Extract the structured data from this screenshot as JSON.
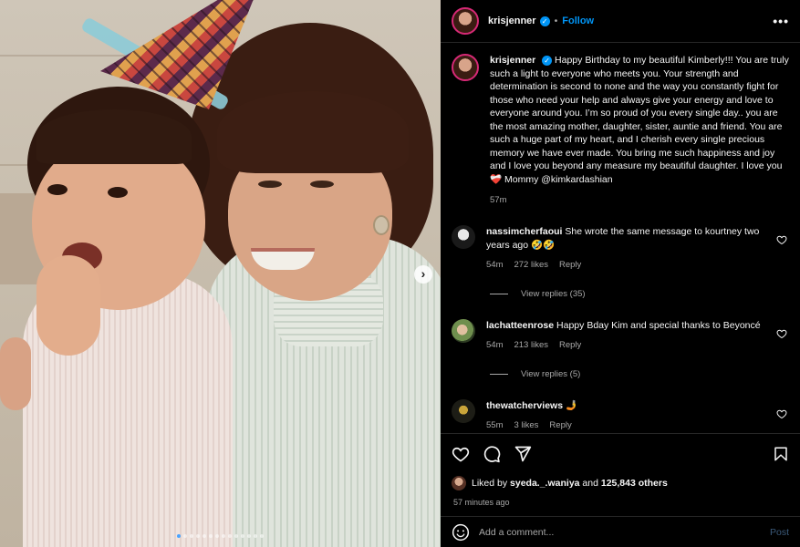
{
  "colors": {
    "accent": "#0095f6",
    "background": "#000000",
    "muted": "#a8a8a8",
    "heart": "#ed4956"
  },
  "photo": {
    "carousel_dot_count": 14,
    "active_dot_index": 0
  },
  "header": {
    "username": "krisjenner",
    "separator": "•",
    "follow_label": "Follow",
    "more_label": "•••"
  },
  "caption": {
    "username": "krisjenner",
    "text": "Happy Birthday to my beautiful Kimberly!!! You are truly such a light to everyone who meets you. Your strength and determination is second to none and the way you constantly fight for those who need your help and always give your energy and love to everyone around you. I’m so proud of you every single day.. you are the most amazing mother, daughter, sister, auntie and friend. You are such a huge part of my heart, and I cherish every single precious memory we have ever made. You bring me such happiness and joy and I love you beyond any measure my beautiful daughter. I love you ❤️‍🩹 Mommy @kimkardashian",
    "time": "57m"
  },
  "comments": [
    {
      "username": "nassimcherfaoui",
      "text": "She wrote the same message to kourtney two years ago 🤣🤣",
      "time": "54m",
      "likes": "272 likes",
      "reply": "Reply",
      "view_replies": "View replies (35)",
      "avatar_color": "#d0d0d0"
    },
    {
      "username": "lachatteenrose",
      "text": "Happy Bday Kim and special thanks to Beyoncé",
      "time": "54m",
      "likes": "213 likes",
      "reply": "Reply",
      "view_replies": "View replies (5)",
      "avatar_color": "#7a9a5c"
    },
    {
      "username": "thewatcherviews",
      "text": "🤳",
      "time": "55m",
      "likes": "3 likes",
      "reply": "Reply",
      "avatar_color": "#3a3a2a"
    }
  ],
  "likes": {
    "prefix": "Liked by ",
    "user": "syeda._.waniya",
    "middle": " and ",
    "count": "125,843 others"
  },
  "posted": "57 minutes ago",
  "add_comment": {
    "placeholder": "Add a comment...",
    "post_label": "Post"
  }
}
